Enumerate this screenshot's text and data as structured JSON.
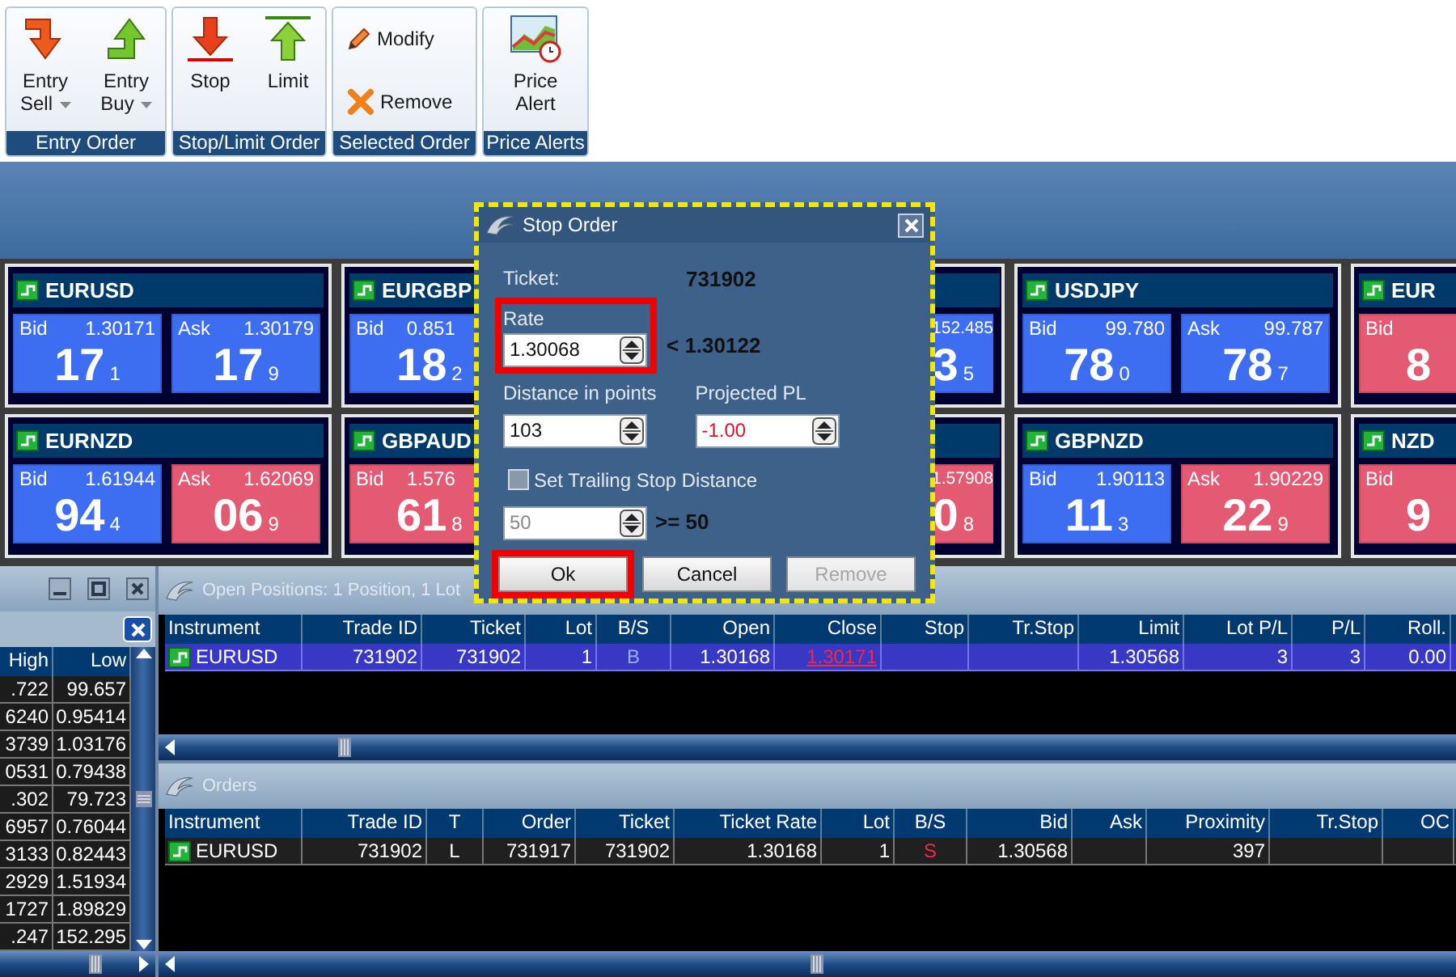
{
  "ribbon": {
    "groups": [
      {
        "label": "Entry Order",
        "kind": "large",
        "buttons": [
          {
            "label": "Entry Sell",
            "kind": "entry_sell",
            "dropdown": true
          },
          {
            "label": "Entry Buy",
            "kind": "entry_buy",
            "dropdown": true
          }
        ]
      },
      {
        "label": "Stop/Limit Order",
        "kind": "large",
        "buttons": [
          {
            "label": "Stop",
            "kind": "stop",
            "dropdown": false
          },
          {
            "label": "Limit",
            "kind": "limit",
            "dropdown": false
          }
        ]
      },
      {
        "label": "Selected Order",
        "kind": "small",
        "buttons": [
          {
            "label": "Modify",
            "kind": "modify"
          },
          {
            "label": "Remove",
            "kind": "remove"
          }
        ]
      },
      {
        "label": "Price Alerts",
        "kind": "large",
        "buttons": [
          {
            "label": "Price Alert",
            "kind": "price_alert",
            "dropdown": false
          }
        ]
      }
    ]
  },
  "tiles": {
    "rows": [
      [
        {
          "kind": "whole",
          "symbol": "EURUSD",
          "bid": {
            "label": "Bid",
            "price": "1.30171",
            "big": "17",
            "small": "1",
            "color": "#3d6df0"
          },
          "ask": {
            "label": "Ask",
            "price": "1.30179",
            "big": "17",
            "small": "9",
            "color": "#3d6df0"
          }
        },
        {
          "kind": "cut_right",
          "symbol": "EURGBP",
          "bid": {
            "label": "Bid",
            "price": "0.851",
            "big": "18",
            "small": "2",
            "color": "#3d6df0"
          }
        },
        {
          "kind": "cut_left",
          "ask": {
            "price": "152.485",
            "big": "3",
            "small": "5",
            "color": "#3d6df0"
          }
        },
        {
          "kind": "whole",
          "symbol": "USDJPY",
          "bid": {
            "label": "Bid",
            "price": "99.780",
            "big": "78",
            "small": "0",
            "color": "#3d6df0"
          },
          "ask": {
            "label": "Ask",
            "price": "99.787",
            "big": "78",
            "small": "7",
            "color": "#3d6df0"
          }
        },
        {
          "kind": "cut_right",
          "symbol": "EUR",
          "bid": {
            "label": "Bid",
            "big": "8",
            "color": "#e45a72"
          }
        }
      ],
      [
        {
          "kind": "whole",
          "symbol": "EURNZD",
          "bid": {
            "label": "Bid",
            "price": "1.61944",
            "big": "94",
            "small": "4",
            "color": "#3d6df0"
          },
          "ask": {
            "label": "Ask",
            "price": "1.62069",
            "big": "06",
            "small": "9",
            "color": "#e45a72"
          }
        },
        {
          "kind": "cut_right",
          "symbol": "GBPAUD",
          "bid": {
            "label": "Bid",
            "price": "1.576",
            "big": "61",
            "small": "8",
            "color": "#e45a72"
          }
        },
        {
          "kind": "cut_left",
          "ask": {
            "price": "1.57908",
            "big": "0",
            "small": "8",
            "color": "#e45a72"
          }
        },
        {
          "kind": "whole",
          "symbol": "GBPNZD",
          "bid": {
            "label": "Bid",
            "price": "1.90113",
            "big": "11",
            "small": "3",
            "color": "#3d6df0"
          },
          "ask": {
            "label": "Ask",
            "price": "1.90229",
            "big": "22",
            "small": "9",
            "color": "#e45a72"
          }
        },
        {
          "kind": "cut_right",
          "symbol": "NZD",
          "bid": {
            "label": "Bid",
            "big": "9",
            "color": "#e45a72"
          }
        }
      ]
    ]
  },
  "rates_panel": {
    "columns": [
      "High",
      "Low"
    ],
    "rows": [
      [
        ".722",
        "99.657"
      ],
      [
        "6240",
        "0.95414"
      ],
      [
        "3739",
        "1.03176"
      ],
      [
        "0531",
        "0.79438"
      ],
      [
        ".302",
        "79.723"
      ],
      [
        "6957",
        "0.76044"
      ],
      [
        "3133",
        "0.82443"
      ],
      [
        "2929",
        "1.51934"
      ],
      [
        "1727",
        "1.89829"
      ],
      [
        ".247",
        "152.295"
      ]
    ]
  },
  "open_positions": {
    "title": "Open Positions: 1 Position, 1 Lot",
    "columns": [
      "Instrument",
      "Trade ID",
      "Ticket",
      "Lot",
      "B/S",
      "Open",
      "Close",
      "Stop",
      "Tr.Stop",
      "Limit",
      "Lot P/L",
      "P/L",
      "Roll."
    ],
    "rows": [
      {
        "selected": true,
        "cells": [
          "EURUSD",
          "731902",
          "731902",
          "1",
          {
            "text": "B",
            "color": "#9aaeff"
          },
          "1.30168",
          {
            "text": "1.30171",
            "color": "#f0284a",
            "underlined": true
          },
          null,
          null,
          "1.30568",
          "3",
          "3",
          "0.00"
        ]
      }
    ]
  },
  "orders": {
    "title": "Orders",
    "columns": [
      "Instrument",
      "Trade ID",
      "T",
      "Order",
      "Ticket",
      "Ticket Rate",
      "Lot",
      "B/S",
      "Bid",
      "Ask",
      "Proximity",
      "Tr.Stop",
      "OC"
    ],
    "rows": [
      {
        "selected": false,
        "cells": [
          "EURUSD",
          "731902",
          "L",
          "731917",
          "731902",
          "1.30168",
          "1",
          {
            "text": "S",
            "color": "#f0284a"
          },
          "1.30568",
          null,
          "397",
          null,
          null
        ]
      }
    ]
  },
  "dialog": {
    "title": "Stop Order",
    "ticket_label": "Ticket:",
    "ticket": "731902",
    "rate": {
      "label": "Rate",
      "value": "1.30068",
      "highlighted": true
    },
    "rate_limit": "< 1.30122",
    "distance": {
      "label": "Distance in points",
      "value": "103"
    },
    "projected_pl": {
      "label": "Projected PL",
      "value": "-1.00",
      "negative": true
    },
    "trailing": {
      "label": "Set Trailing Stop Distance",
      "checked": false,
      "value": "50",
      "disabled": true,
      "minimum": ">= 50"
    },
    "buttons": [
      {
        "label": "Ok",
        "disabled": false,
        "highlighted": true
      },
      {
        "label": "Cancel",
        "disabled": false,
        "highlighted": false
      },
      {
        "label": "Remove",
        "disabled": true,
        "highlighted": false
      }
    ]
  }
}
